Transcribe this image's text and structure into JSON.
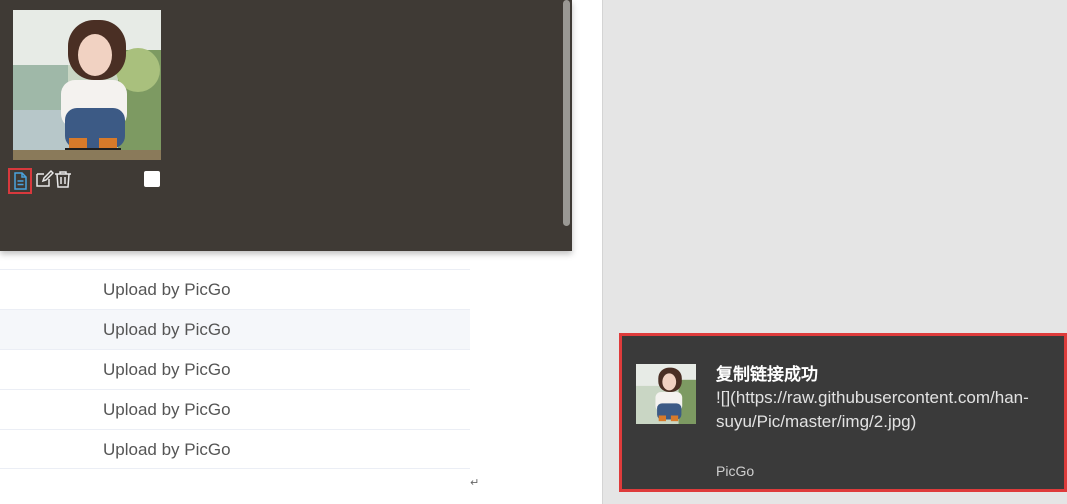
{
  "table": {
    "rows": [
      {
        "description": "Upload by PicGo"
      },
      {
        "description": "Upload by PicGo"
      },
      {
        "description": "Upload by PicGo"
      },
      {
        "description": "Upload by PicGo"
      },
      {
        "description": "Upload by PicGo"
      }
    ],
    "return_mark": "↵"
  },
  "gallery": {
    "actions": [
      "copy-link-icon",
      "edit-icon",
      "delete-icon"
    ],
    "checkbox_checked": false
  },
  "notification": {
    "title": "复制链接成功",
    "body": "![](https://raw.githubusercontent.com/han-suyu/Pic/master/img/2.jpg)",
    "source": "PicGo",
    "colors": {
      "background": "#3a3a3a",
      "highlight_border": "#de3b3b"
    }
  },
  "colors": {
    "gallery_bg": "#3f3a35",
    "accent_icon": "#4aa3df"
  }
}
